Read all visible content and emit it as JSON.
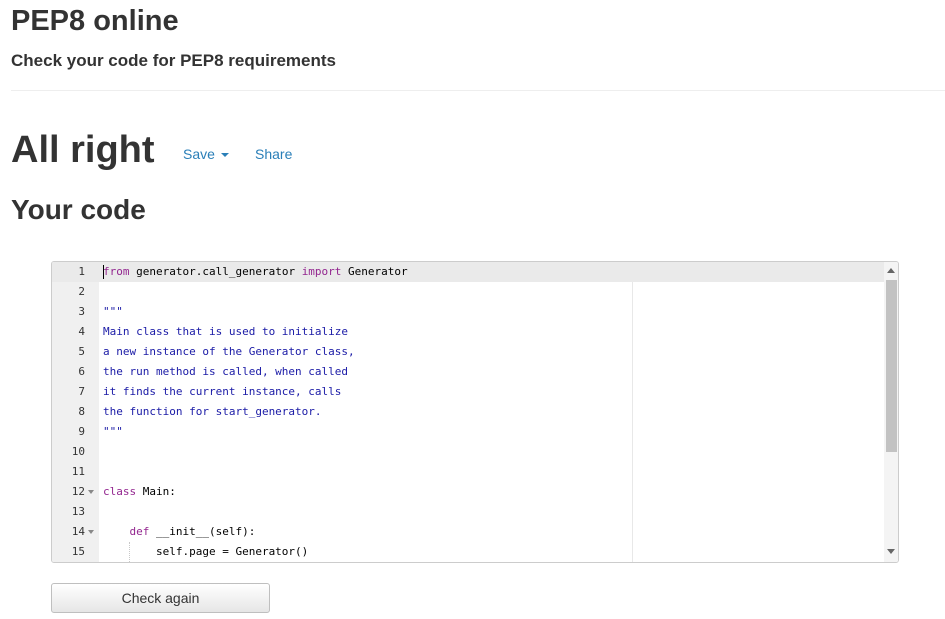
{
  "header": {
    "title": "PEP8 online",
    "subtitle": "Check your code for PEP8 requirements"
  },
  "result": {
    "title": "All right",
    "save_label": "Save",
    "share_label": "Share"
  },
  "code_section": {
    "heading": "Your code"
  },
  "editor": {
    "lines": [
      {
        "n": "1",
        "fold": false,
        "tokens": [
          {
            "t": "from",
            "c": "kw"
          },
          {
            "t": " generator.call_generator ",
            "c": ""
          },
          {
            "t": "import",
            "c": "kw"
          },
          {
            "t": " Generator",
            "c": ""
          }
        ]
      },
      {
        "n": "2",
        "fold": false,
        "tokens": []
      },
      {
        "n": "3",
        "fold": false,
        "tokens": [
          {
            "t": "\"\"\"",
            "c": "str"
          }
        ]
      },
      {
        "n": "4",
        "fold": false,
        "tokens": [
          {
            "t": "Main class that is used to initialize",
            "c": "str"
          }
        ]
      },
      {
        "n": "5",
        "fold": false,
        "tokens": [
          {
            "t": "a new instance of the Generator class,",
            "c": "str"
          }
        ]
      },
      {
        "n": "6",
        "fold": false,
        "tokens": [
          {
            "t": "the run method is called, when called",
            "c": "str"
          }
        ]
      },
      {
        "n": "7",
        "fold": false,
        "tokens": [
          {
            "t": "it finds the current instance, calls",
            "c": "str"
          }
        ]
      },
      {
        "n": "8",
        "fold": false,
        "tokens": [
          {
            "t": "the function for start_generator.",
            "c": "str"
          }
        ]
      },
      {
        "n": "9",
        "fold": false,
        "tokens": [
          {
            "t": "\"\"\"",
            "c": "str"
          }
        ]
      },
      {
        "n": "10",
        "fold": false,
        "tokens": []
      },
      {
        "n": "11",
        "fold": false,
        "tokens": []
      },
      {
        "n": "12",
        "fold": true,
        "tokens": [
          {
            "t": "class",
            "c": "kw"
          },
          {
            "t": " Main:",
            "c": ""
          }
        ]
      },
      {
        "n": "13",
        "fold": false,
        "tokens": []
      },
      {
        "n": "14",
        "fold": true,
        "tokens": [
          {
            "t": "    ",
            "c": ""
          },
          {
            "t": "def",
            "c": "kw"
          },
          {
            "t": " __init__(self):",
            "c": ""
          }
        ]
      },
      {
        "n": "15",
        "fold": false,
        "guide": true,
        "tokens": [
          {
            "t": "        self.page = Generator()",
            "c": ""
          }
        ]
      }
    ]
  },
  "actions": {
    "check_again_label": "Check again"
  }
}
